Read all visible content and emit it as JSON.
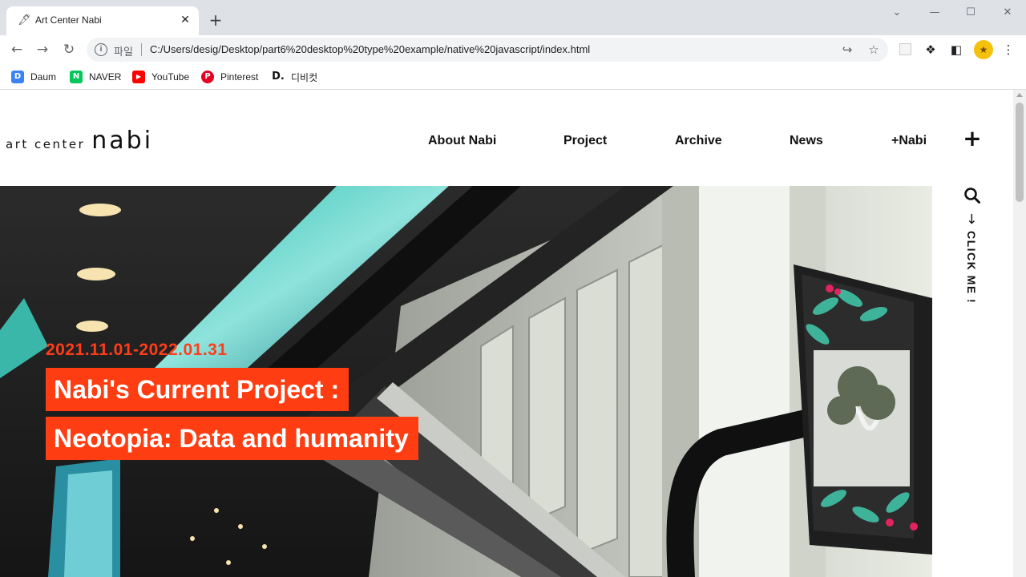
{
  "browser": {
    "tab": {
      "title": "Art Center Nabi",
      "favicon": "feather-icon"
    },
    "new_tab_icon": "+",
    "window_controls": {
      "dropdown": "⌄",
      "minimize": "—",
      "maximize": "☐",
      "close": "✕"
    },
    "address": {
      "protocol_label": "파일",
      "url": "C:/Users/desig/Desktop/part6%20desktop%20type%20example/native%20javascript/index.html"
    },
    "bookmarks": [
      {
        "label": "Daum",
        "color": "#3b82f6",
        "glyph": "D"
      },
      {
        "label": "NAVER",
        "color": "#03c75a",
        "glyph": "N"
      },
      {
        "label": "YouTube",
        "color": "#ff0000",
        "glyph": "▶"
      },
      {
        "label": "Pinterest",
        "color": "#e60023",
        "glyph": "P"
      },
      {
        "label": "디비컷",
        "color": "#111111",
        "glyph": "D."
      }
    ]
  },
  "site": {
    "logo": {
      "small": "art center",
      "big": "nabi"
    },
    "nav": [
      "About Nabi",
      "Project",
      "Archive",
      "News",
      "+Nabi"
    ],
    "plus_icon": "+",
    "side": {
      "click_label": "CLICK ME !",
      "arrow": "→"
    },
    "hero": {
      "date": "2021.11.01-2022.01.31",
      "title_lines": [
        "Nabi's Current Project :",
        "Neotopia: Data and humanity"
      ]
    }
  },
  "colors": {
    "accent": "#ff3d12",
    "text": "#111111",
    "chrome": "#dee1e6"
  }
}
